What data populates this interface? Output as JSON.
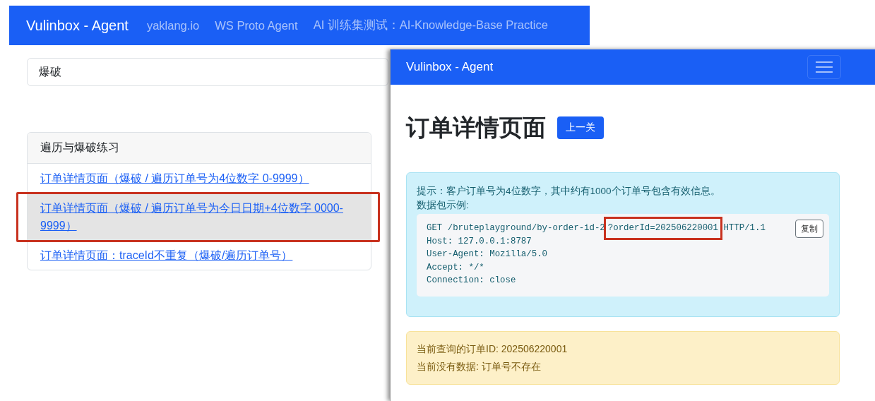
{
  "back_window": {
    "navbar": {
      "brand": "Vulinbox - Agent",
      "links": [
        "yaklang.io",
        "WS Proto Agent",
        "AI 训练集测试：AI-Knowledge-Base Practice"
      ]
    },
    "search": {
      "value": "爆破"
    },
    "card": {
      "title": "遍历与爆破练习",
      "items": [
        {
          "label": "订单详情页面（爆破 / 遍历订单号为4位数字 0-9999）",
          "selected": false,
          "marked": false
        },
        {
          "label": "订单详情页面（爆破 / 遍历订单号为今日日期+4位数字 0000-9999）",
          "selected": true,
          "marked": true
        },
        {
          "label": "订单详情页面：traceId不重复（爆破/遍历订单号）",
          "selected": false,
          "marked": false
        }
      ]
    }
  },
  "front_window": {
    "navbar": {
      "brand": "Vulinbox - Agent"
    },
    "heading": "订单详情页面",
    "back_button": "上一关",
    "info_alert": {
      "hint": "提示：客户订单号为4位数字，其中约有1000个订单号包含有效信息。",
      "example_label": "数据包示例:",
      "copy_button": "复制",
      "request": [
        {
          "before": "GET /bruteplayground/by-order-id-2",
          "marked_text": "?orderId=202506220001",
          "after": " HTTP/1.1"
        },
        "Host: 127.0.0.1:8787",
        "User-Agent: Mozilla/5.0",
        "Accept: */*",
        "Connection: close"
      ]
    },
    "warning_alert": {
      "lines": [
        "当前查询的订单ID: 202506220001",
        "当前没有数据: 订单号不存在"
      ]
    }
  }
}
